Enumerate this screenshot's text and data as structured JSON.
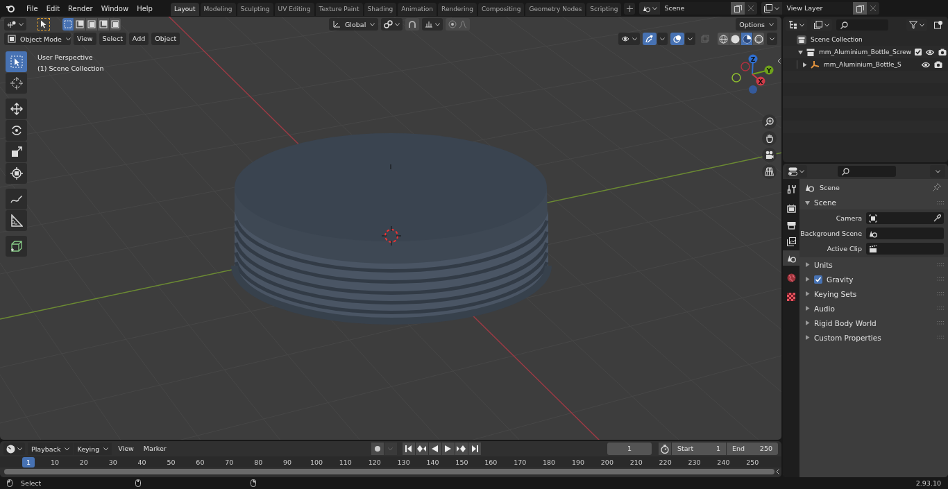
{
  "menu": [
    "File",
    "Edit",
    "Render",
    "Window",
    "Help"
  ],
  "workspaces": [
    {
      "label": "Layout",
      "selected": true
    },
    {
      "label": "Modeling",
      "selected": false
    },
    {
      "label": "Sculpting",
      "selected": false
    },
    {
      "label": "UV Editing",
      "selected": false
    },
    {
      "label": "Texture Paint",
      "selected": false
    },
    {
      "label": "Shading",
      "selected": false
    },
    {
      "label": "Animation",
      "selected": false
    },
    {
      "label": "Rendering",
      "selected": false
    },
    {
      "label": "Compositing",
      "selected": false
    },
    {
      "label": "Geometry Nodes",
      "selected": false
    },
    {
      "label": "Scripting",
      "selected": false
    }
  ],
  "scene": {
    "value": "Scene"
  },
  "view_layer": {
    "value": "View Layer"
  },
  "viewport": {
    "select_modes": [
      {
        "selected": true
      },
      {
        "selected": false
      },
      {
        "selected": false
      },
      {
        "selected": false
      },
      {
        "selected": false
      }
    ],
    "orientation": "Global",
    "options": "Options",
    "mode": "Object Mode",
    "menus": [
      "View",
      "Select",
      "Add",
      "Object"
    ],
    "proportional_edit_on": false,
    "gizmos_on": true,
    "overlays_on": true,
    "shading": [
      {
        "kind": "wireframe",
        "selected": false
      },
      {
        "kind": "solid",
        "selected": false
      },
      {
        "kind": "material",
        "selected": true
      },
      {
        "kind": "rendered",
        "selected": false
      }
    ],
    "overlay_text": [
      "User Perspective",
      "(1) Scene Collection"
    ],
    "tools": [
      {
        "kind": "select",
        "selected": true
      },
      {
        "kind": "cursor",
        "selected": false
      },
      {
        "kind": "move",
        "selected": false
      },
      {
        "kind": "rotate",
        "selected": false
      },
      {
        "kind": "scale",
        "selected": false
      },
      {
        "kind": "transform",
        "selected": false
      },
      {
        "kind": "annotate",
        "selected": false
      },
      {
        "kind": "measure",
        "selected": false
      },
      {
        "kind": "add_cube",
        "selected": false
      }
    ],
    "gizmo": [
      "Z",
      "Y",
      "X"
    ]
  },
  "outliner": {
    "root": {
      "label": "Scene Collection",
      "children": [
        {
          "label": "mm_Aluminium_Bottle_Screw",
          "expanded": true,
          "checked": true,
          "children": [
            {
              "label": "mm_Aluminium_Bottle_S",
              "expanded": false
            }
          ]
        }
      ]
    }
  },
  "properties": {
    "tabs": [
      {
        "kind": "tool",
        "selected": false
      },
      {
        "kind": "render",
        "selected": false
      },
      {
        "kind": "output",
        "selected": false
      },
      {
        "kind": "view_layer",
        "selected": false
      },
      {
        "kind": "scene",
        "selected": true
      },
      {
        "kind": "world",
        "selected": false
      },
      {
        "kind": "texture",
        "selected": false
      }
    ],
    "title": "Scene",
    "panel": {
      "title": "Scene",
      "expanded": true,
      "fields": [
        {
          "label": "Camera",
          "kind": "camera"
        },
        {
          "label": "Background Scene",
          "kind": "scene"
        },
        {
          "label": "Active Clip",
          "kind": "clip"
        }
      ]
    },
    "subpanels": [
      {
        "label": "Units",
        "kind": "plain",
        "expanded": false
      },
      {
        "label": "Gravity",
        "kind": "checkbox",
        "checked": true,
        "expanded": false
      },
      {
        "label": "Keying Sets",
        "kind": "plain",
        "expanded": false
      },
      {
        "label": "Audio",
        "kind": "plain",
        "expanded": false
      },
      {
        "label": "Rigid Body World",
        "kind": "plain",
        "expanded": false
      },
      {
        "label": "Custom Properties",
        "kind": "plain",
        "expanded": false
      }
    ]
  },
  "timeline": {
    "menus": [
      "Playback",
      "Keying"
    ],
    "links": [
      "View",
      "Marker"
    ],
    "current_frame": "1",
    "start": {
      "label": "Start",
      "value": "1"
    },
    "end": {
      "label": "End",
      "value": "250"
    },
    "playhead": "1",
    "ticks": [
      "10",
      "20",
      "30",
      "40",
      "50",
      "60",
      "70",
      "80",
      "90",
      "100",
      "110",
      "120",
      "130",
      "140",
      "150",
      "160",
      "170",
      "180",
      "190",
      "200",
      "210",
      "220",
      "230",
      "240",
      "250"
    ]
  },
  "status_bar": {
    "hint": "Select",
    "version": "2.93.10"
  }
}
